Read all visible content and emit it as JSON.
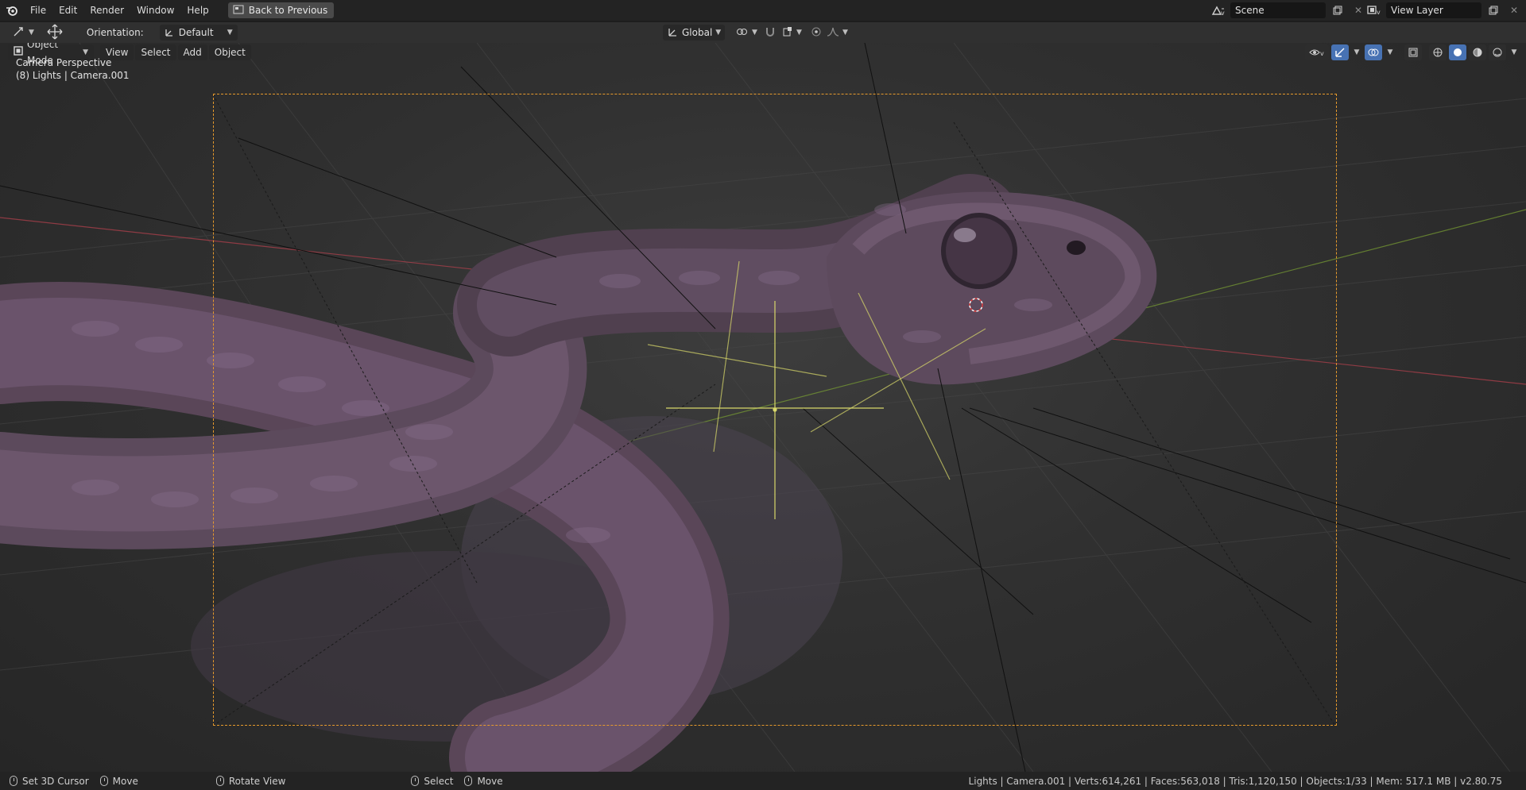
{
  "menu": {
    "items": [
      "File",
      "Edit",
      "Render",
      "Window",
      "Help"
    ],
    "back_to_previous": "Back to Previous"
  },
  "scene": {
    "label": "Scene"
  },
  "view_layer": {
    "label": "View Layer"
  },
  "toolbar": {
    "orientation_label": "Orientation:",
    "orientation_value": "Default",
    "transform_orientation": "Global"
  },
  "viewport": {
    "mode": "Object Mode",
    "menus": [
      "View",
      "Select",
      "Add",
      "Object"
    ],
    "overlay_title": "Camera Perspective",
    "overlay_subtitle": "(8) Lights | Camera.001"
  },
  "statusbar": {
    "actions": [
      "Set 3D Cursor",
      "Move",
      "Rotate View",
      "Select",
      "Move"
    ],
    "stats": "Lights | Camera.001 | Verts:614,261 | Faces:563,018 | Tris:1,120,150 | Objects:1/33 | Mem: 517.1 MB | v2.80.75"
  },
  "colors": {
    "accent_blue": "#4772b3",
    "camera_frame": "#e79a2c",
    "light_gizmo": "#d8d86a",
    "x_axis": "#b0404c",
    "y_axis": "#7aa033"
  },
  "icons": [
    "blender-logo-icon",
    "back-icon",
    "scene-icon",
    "view-layer-icon",
    "move-tool-icon",
    "transform-icon",
    "pivot-icon",
    "snap-icon",
    "proportional-icon",
    "object-mode-icon",
    "visibility-icon",
    "gizmo-icon",
    "overlay-icon",
    "xray-icon",
    "wireframe-shading-icon",
    "solid-shading-icon",
    "material-shading-icon",
    "rendered-shading-icon"
  ]
}
